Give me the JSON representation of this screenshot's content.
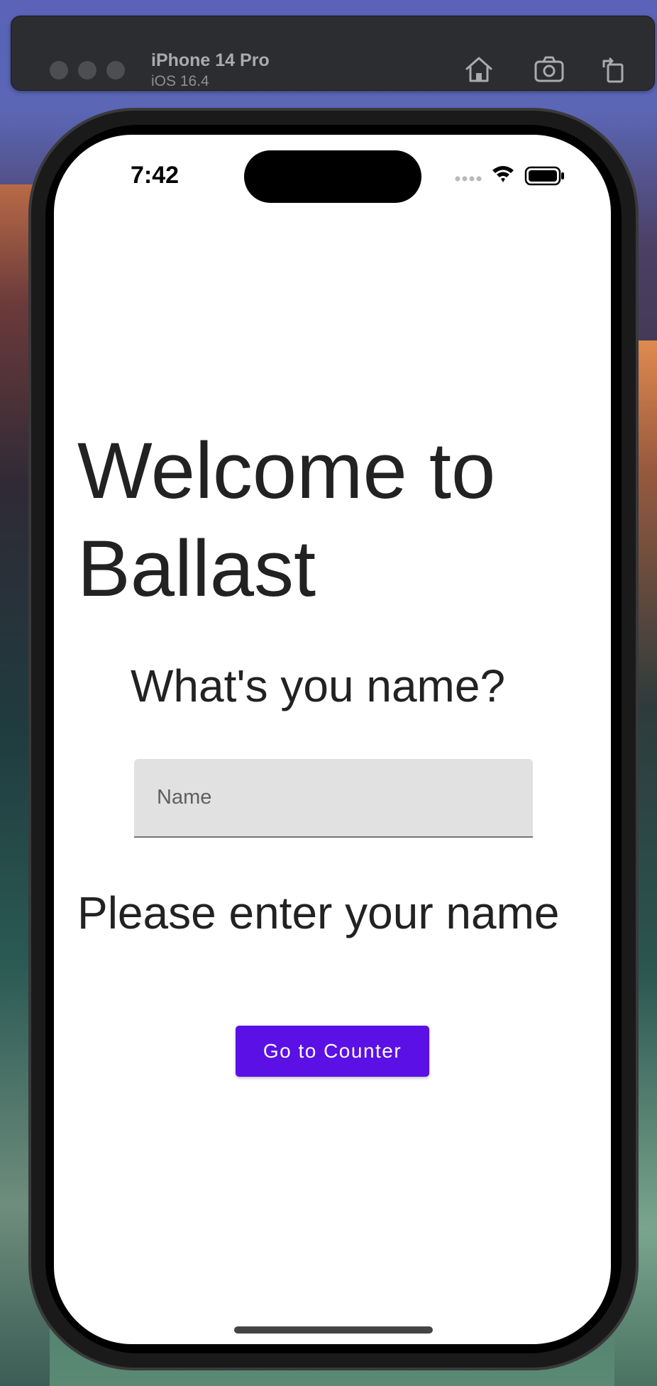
{
  "simulator": {
    "device_name": "iPhone 14 Pro",
    "os_version": "iOS 16.4"
  },
  "status_bar": {
    "time": "7:42"
  },
  "app": {
    "title": "Welcome to Ballast",
    "question": "What's you name?",
    "name_field": {
      "placeholder": "Name",
      "value": ""
    },
    "validation_message": "Please enter your name",
    "go_button_label": "Go to Counter"
  },
  "colors": {
    "button_bg": "#5b10e6",
    "field_bg": "#e1e1e1"
  }
}
